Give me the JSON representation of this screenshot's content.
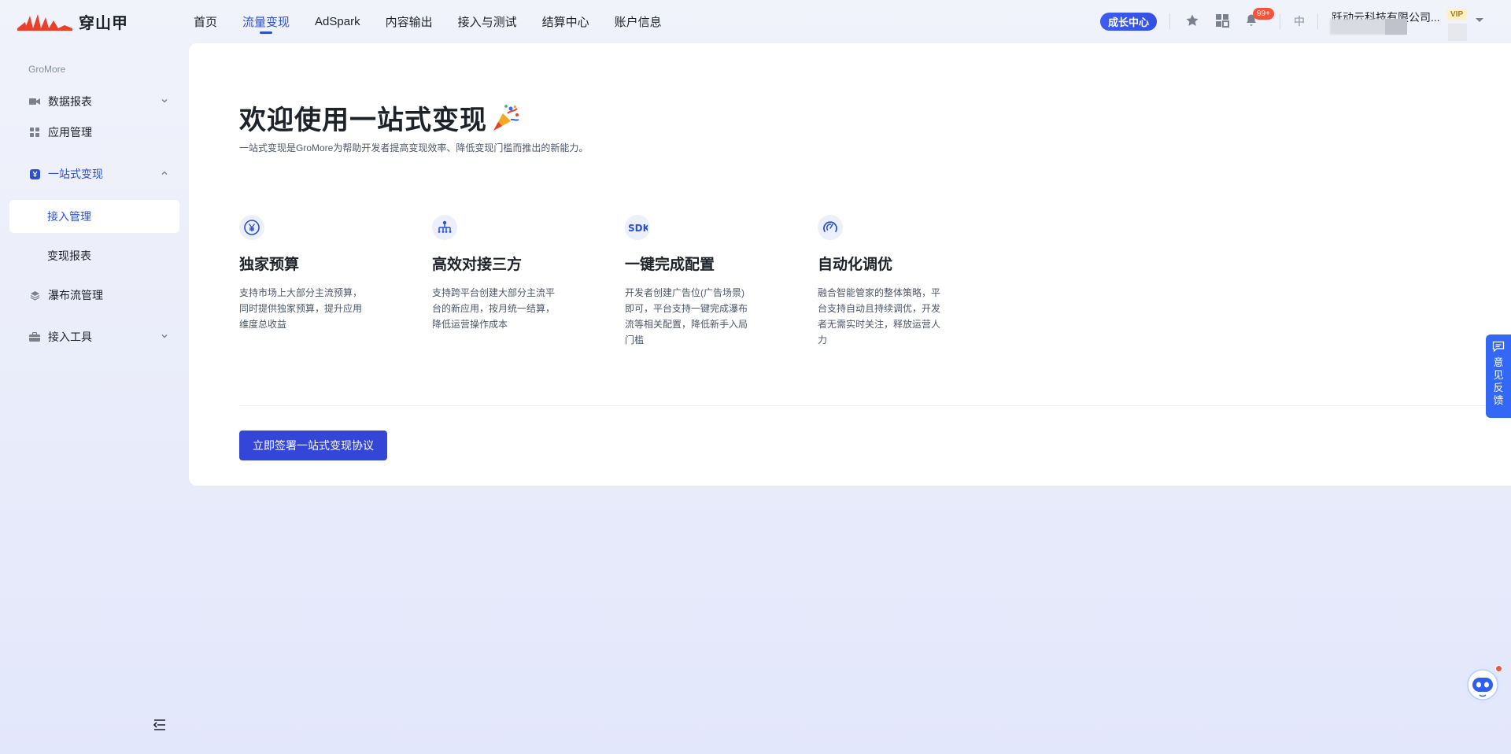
{
  "brand": {
    "name": "穿山甲"
  },
  "topnav": {
    "items": [
      {
        "label": "首页"
      },
      {
        "label": "流量变现"
      },
      {
        "label": "AdSpark"
      },
      {
        "label": "内容输出"
      },
      {
        "label": "接入与测试"
      },
      {
        "label": "结算中心"
      },
      {
        "label": "账户信息"
      }
    ],
    "active_index": 1
  },
  "header": {
    "growth_center": "成长中心",
    "bell_badge": "99+",
    "language": "中",
    "account_name": "跃动云科技有限公司...",
    "vip": "VIP"
  },
  "sidebar": {
    "section_title": "GroMore",
    "items": [
      {
        "label": "数据报表",
        "icon": "video-icon",
        "caret": "down"
      },
      {
        "label": "应用管理",
        "icon": "grid-icon"
      },
      {
        "label": "一站式变现",
        "icon": "yen-icon",
        "caret": "up",
        "open": true
      },
      {
        "label": "瀑布流管理",
        "icon": "layers-icon"
      },
      {
        "label": "接入工具",
        "icon": "toolbox-icon",
        "caret": "down"
      }
    ],
    "submenu": [
      {
        "label": "接入管理",
        "active": true
      },
      {
        "label": "变现报表"
      }
    ]
  },
  "main": {
    "title": "欢迎使用一站式变现",
    "subtitle": "一站式变现是GroMore为帮助开发者提高变现效率、降低变现门槛而推出的新能力。",
    "features": [
      {
        "icon": "yen-circle-icon",
        "title": "独家预算",
        "desc": "支持市场上大部分主流预算，同时提供独家预算，提升应用维度总收益"
      },
      {
        "icon": "network-icon",
        "title": "高效对接三方",
        "desc": "支持跨平台创建大部分主流平台的新应用，按月统一结算，降低运营操作成本"
      },
      {
        "icon": "sdk-icon",
        "title": "一键完成配置",
        "desc": "开发者创建广告位(广告场景)即可，平台支持一键完成瀑布流等相关配置，降低新手入局门槛"
      },
      {
        "icon": "gauge-icon",
        "title": "自动化调优",
        "desc": "融合智能管家的整体策略，平台支持自动且持续调优，开发者无需实时关注，释放运营人力"
      }
    ],
    "cta": "立即签署一站式变现协议"
  },
  "floating": {
    "feedback": "意见反馈"
  },
  "colors": {
    "accent": "#2b50d6",
    "button": "#3346d8",
    "badge": "#f5533d"
  }
}
